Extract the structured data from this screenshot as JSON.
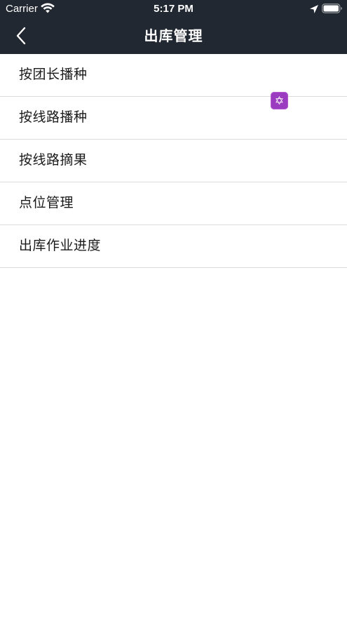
{
  "status_bar": {
    "carrier": "Carrier",
    "time": "5:17 PM",
    "icons": [
      "wifi-icon",
      "location-arrow-icon",
      "battery-icon"
    ]
  },
  "nav_bar": {
    "title": "出库管理",
    "back_icon": "chevron-left-icon",
    "background_color": "#222831"
  },
  "menu": {
    "items": [
      {
        "label": "按团长播种"
      },
      {
        "label": "按线路播种"
      },
      {
        "label": "按线路摘果"
      },
      {
        "label": "点位管理"
      },
      {
        "label": "出库作业进度"
      }
    ]
  },
  "floating_badge": {
    "icon": "star-of-david-icon",
    "glyph": "✡",
    "color": "#9b3bbf"
  }
}
